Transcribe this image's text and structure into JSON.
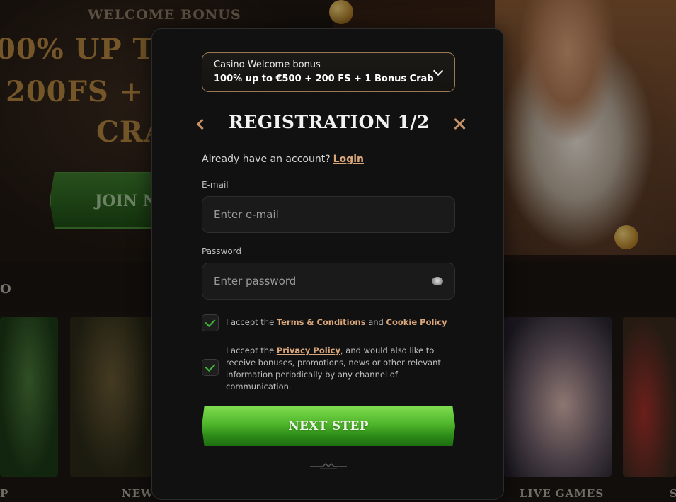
{
  "background": {
    "hero_heading": "WELCOME BONUS",
    "hero_line1": "00% UP T",
    "hero_line2": "200FS + 1",
    "hero_line3": "CRA",
    "join_label": "JOIN N",
    "section_label": "O",
    "tile_labels": [
      "P",
      "NEW",
      "LIVE GAMES",
      "S"
    ]
  },
  "bonus_select": {
    "title": "Casino Welcome bonus",
    "value": "100% up to €500 + 200 FS + 1 Bonus Crab"
  },
  "header": {
    "title": "REGISTRATION 1/2"
  },
  "account": {
    "prompt": "Already have an account?",
    "login_label": "Login"
  },
  "email": {
    "label": "E-mail",
    "placeholder": "Enter e-mail"
  },
  "password": {
    "label": "Password",
    "placeholder": "Enter password"
  },
  "terms": {
    "checked": true,
    "prefix": "I accept the",
    "terms_link": "Terms & Conditions",
    "and": "and",
    "cookie_link": "Cookie Policy"
  },
  "privacy": {
    "checked": true,
    "prefix": "I accept the",
    "privacy_link": "Privacy Policy",
    "suffix": ", and would also like to receive bonuses, promotions, news or other relevant information periodically by any channel of communication."
  },
  "next_button": {
    "label": "NEXT STEP"
  },
  "colors": {
    "accent": "#d9a77a",
    "check_green": "#3fbf3a",
    "button_green": "#4fb52a"
  }
}
